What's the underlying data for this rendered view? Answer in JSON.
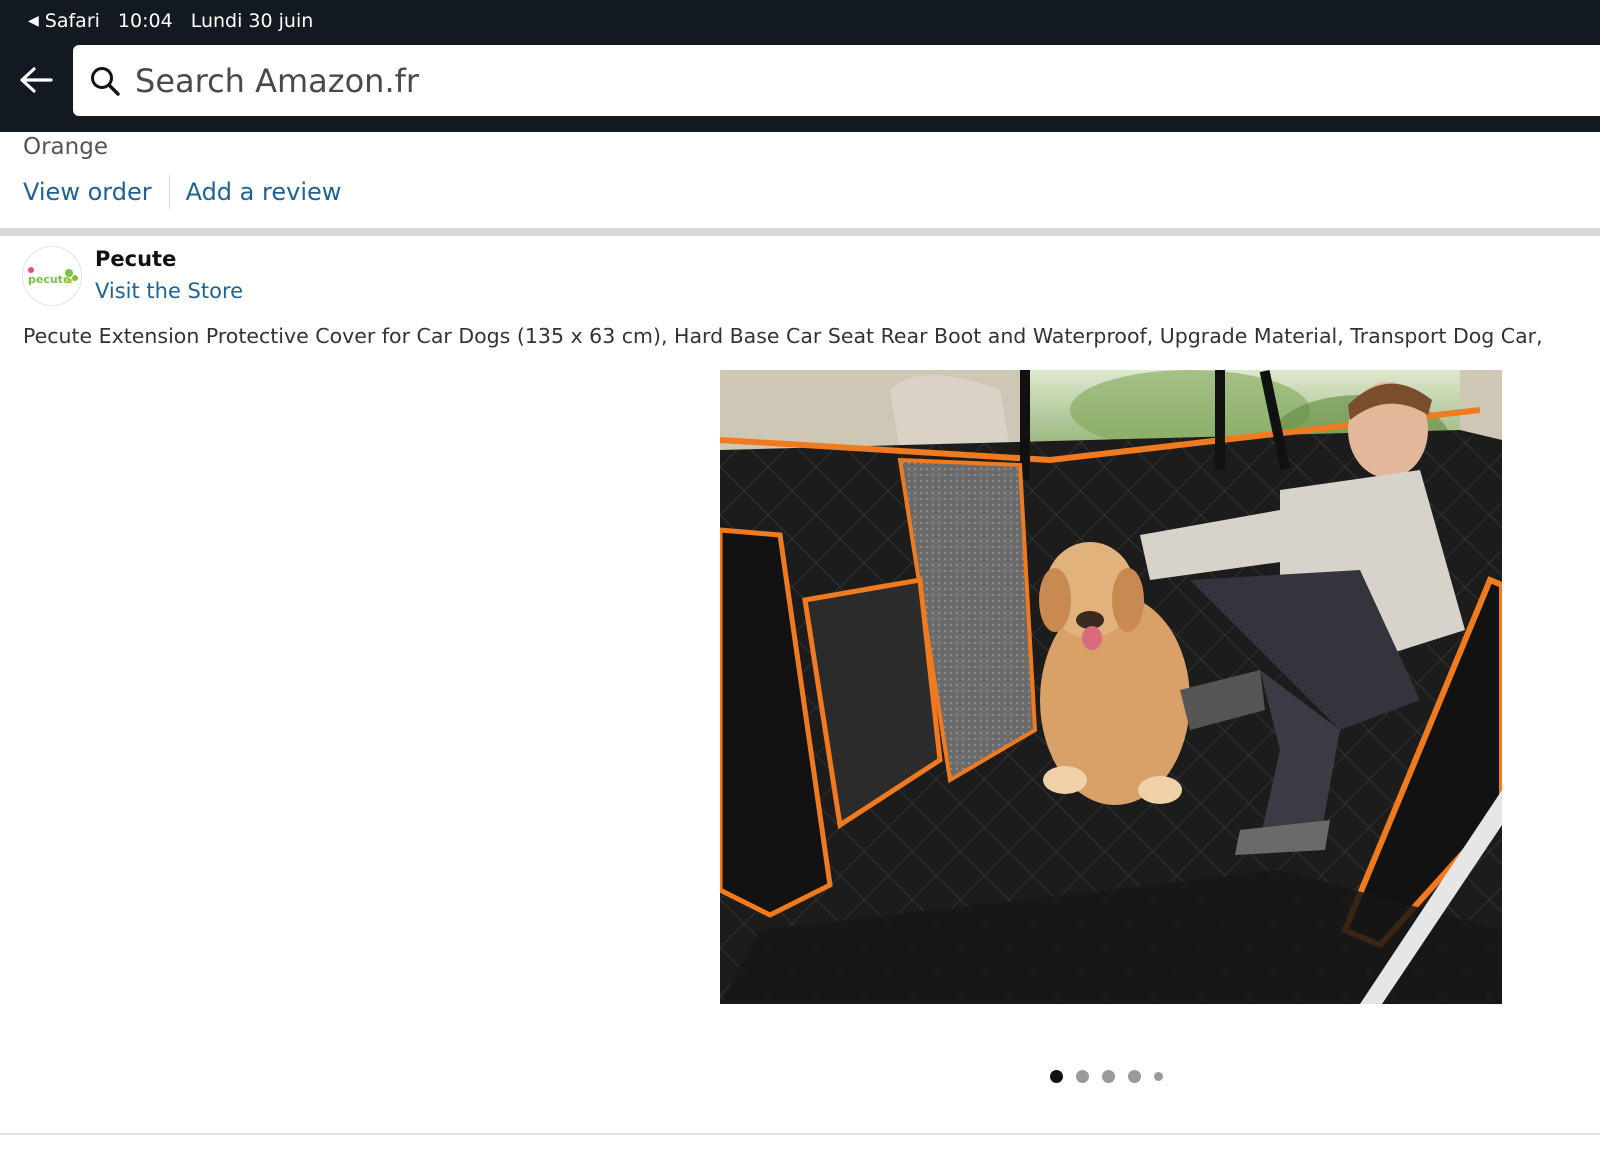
{
  "status_bar": {
    "back_app": "Safari",
    "time": "10:04",
    "date": "Lundi 30 juin"
  },
  "search": {
    "placeholder": "Search Amazon.fr"
  },
  "order": {
    "variant": "Orange",
    "view_order_label": "View order",
    "add_review_label": "Add a review"
  },
  "seller": {
    "brand_name": "Pecute",
    "logo_text": "pecute",
    "visit_store_label": "Visit the Store"
  },
  "product": {
    "title": "Pecute Extension Protective Cover for Car Dogs (135 x 63 cm), Hard Base Car Seat Rear Boot and Waterproof, Upgrade Material, Transport Dog Car,"
  },
  "carousel": {
    "total_dots": 5,
    "active_index": 0
  },
  "colors": {
    "header_bg": "#131921",
    "link": "#1f6296",
    "accent_orange": "#f07a1f"
  }
}
